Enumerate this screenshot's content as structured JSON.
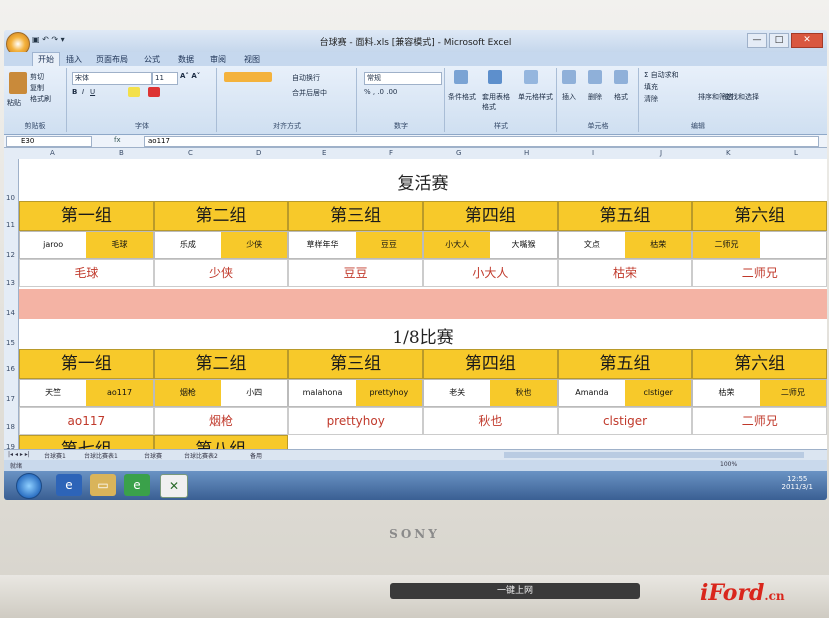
{
  "window": {
    "title": "台球赛 - 面料.xls [兼容模式] - Microsoft Excel",
    "controls": [
      "—",
      "□",
      "✕"
    ]
  },
  "ribbon_tabs": [
    "开始",
    "插入",
    "页面布局",
    "公式",
    "数据",
    "审阅",
    "视图"
  ],
  "ribbon": {
    "clipboard": {
      "label": "剪贴板",
      "paste": "粘贴",
      "cut": "剪切",
      "copy": "复制",
      "format_painter": "格式刷"
    },
    "font": {
      "label": "字体",
      "font_name": "宋体",
      "font_size": "11"
    },
    "alignment": {
      "label": "对齐方式",
      "wrap": "自动换行",
      "merge": "合并后居中"
    },
    "number": {
      "label": "数字",
      "format": "常规"
    },
    "styles": {
      "label": "样式",
      "conditional": "条件格式",
      "table": "套用表格格式",
      "cell": "单元格样式"
    },
    "cells": {
      "label": "单元格",
      "insert": "插入",
      "delete": "删除",
      "format": "格式"
    },
    "editing": {
      "label": "编辑",
      "autosum": "自动求和",
      "fill": "填充",
      "clear": "清除",
      "sort": "排序和筛选",
      "find": "查找和选择"
    }
  },
  "formula_bar": {
    "name_box": "E30",
    "fx": "fx",
    "value": "ao117"
  },
  "columns": [
    "A",
    "B",
    "C",
    "D",
    "E",
    "F",
    "G",
    "H",
    "I",
    "J",
    "K",
    "L"
  ],
  "row_numbers": [
    "10",
    "11",
    "12",
    "13",
    "14",
    "15",
    "16",
    "17",
    "18",
    "19"
  ],
  "section1": {
    "title": "复活赛",
    "groups": [
      "第一组",
      "第二组",
      "第三组",
      "第四组",
      "第五组",
      "第六组"
    ],
    "pairs": [
      [
        "jaroo",
        "毛球"
      ],
      [
        "乐成",
        "少侠"
      ],
      [
        "草样年华",
        "豆豆"
      ],
      [
        "小大人",
        "大嘴猴"
      ],
      [
        "文点",
        "枯荣"
      ],
      [
        "二师兄",
        ""
      ]
    ],
    "winners": [
      "毛球",
      "少侠",
      "豆豆",
      "小大人",
      "枯荣",
      "二师兄"
    ]
  },
  "section2": {
    "title": "1/8比赛",
    "groups": [
      "第一组",
      "第二组",
      "第三组",
      "第四组",
      "第五组",
      "第六组"
    ],
    "pairs": [
      [
        "天竺",
        "ao117"
      ],
      [
        "烟枪",
        "小四"
      ],
      [
        "malahona",
        "prettyhoy"
      ],
      [
        "老关",
        "秋也"
      ],
      [
        "Amanda",
        "clstiger"
      ],
      [
        "枯荣",
        "二师兄"
      ]
    ],
    "winners": [
      "ao117",
      "烟枪",
      "prettyhoy",
      "秋也",
      "clstiger",
      "二师兄"
    ],
    "more_groups": [
      "第七组",
      "第八组"
    ]
  },
  "sheet_tabs": [
    "台球赛1",
    "台球比赛表1",
    "台球赛",
    "台球比赛表2",
    "备用"
  ],
  "status": {
    "ready": "就绪",
    "zoom": "100%"
  },
  "clock": {
    "time": "12:55",
    "date": "2011/3/1"
  },
  "bezel_brand": "SONY",
  "keyboard_button": "一键上网",
  "watermark": {
    "text": "iFord",
    "suffix": ".cn"
  }
}
